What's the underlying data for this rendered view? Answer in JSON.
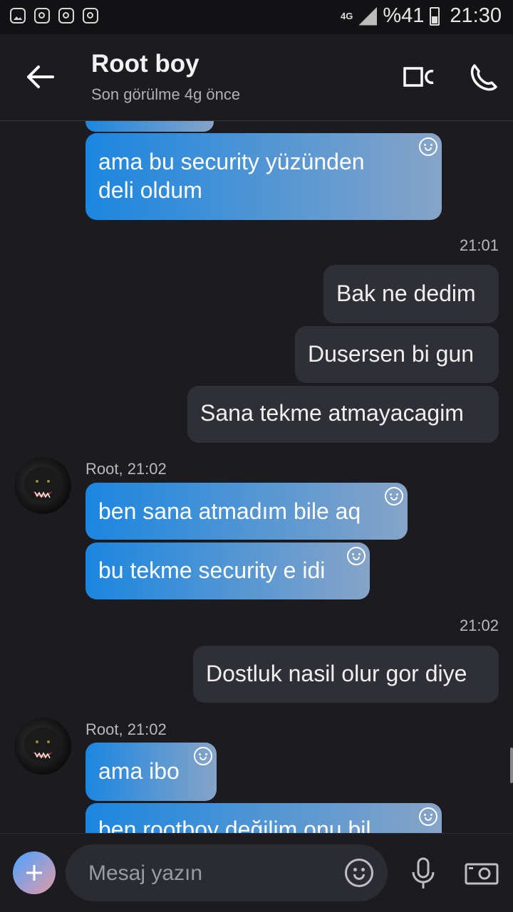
{
  "status_bar": {
    "network": "4G",
    "battery": "%41",
    "time": "21:30"
  },
  "header": {
    "title": "Root boy",
    "subtitle": "Son görülme 4g önce"
  },
  "messages": [
    {
      "dir": "in",
      "text_lines": [
        "ama bu security yüzünden",
        "deli oldum"
      ]
    },
    {
      "type": "time",
      "text": "21:01"
    },
    {
      "dir": "out",
      "text": "Bak ne dedim"
    },
    {
      "dir": "out",
      "text": "Dusersen bi gun"
    },
    {
      "dir": "out",
      "text": "Sana tekme atmayacagim"
    },
    {
      "type": "sender",
      "text": "Root, 21:02"
    },
    {
      "dir": "in",
      "text": "ben sana atmadım bile aq"
    },
    {
      "dir": "in",
      "text": "bu tekme security e idi"
    },
    {
      "type": "time",
      "text": "21:02"
    },
    {
      "dir": "out",
      "text": "Dostluk nasil olur gor diye"
    },
    {
      "type": "sender",
      "text": "Root, 21:02"
    },
    {
      "dir": "in",
      "text": "ama ibo"
    },
    {
      "dir": "in",
      "text": "ben rootboy değilim onu bil"
    }
  ],
  "composer": {
    "placeholder": "Mesaj yazın"
  }
}
